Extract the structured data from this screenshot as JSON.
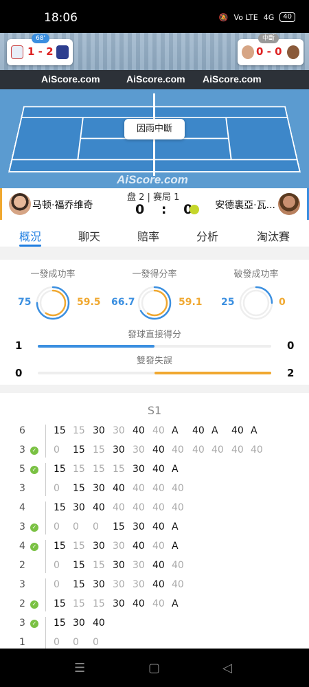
{
  "status": {
    "time": "18:06",
    "battery": "40",
    "signal_text": "4G",
    "volte": "Vo LTE"
  },
  "hero": {
    "ads": [
      "AiScore.com",
      "AiScore.com",
      "AiScore.com"
    ],
    "court_logo": "AiScore.com",
    "rain_label": "因雨中斷",
    "left_card": {
      "minute": "68'",
      "score": "1 - 2"
    },
    "right_card": {
      "status": "中斷",
      "score": "0 - 0"
    }
  },
  "match": {
    "player_left": "马顿·福乔维奇",
    "player_right": "安德裏亞·瓦...",
    "set_info": "盘 2 | 赛局 1",
    "score_left": "0",
    "score_sep": ":",
    "score_right": "0"
  },
  "tabs": [
    "概況",
    "聊天",
    "賠率",
    "分析",
    "淘汰賽"
  ],
  "stats": {
    "first_serve_pct": {
      "title": "一發成功率",
      "left": "75",
      "right": "59.5",
      "left_frac": 0.75,
      "right_frac": 0.595
    },
    "first_serve_won": {
      "title": "一發得分率",
      "left": "66.7",
      "right": "59.1",
      "left_frac": 0.667,
      "right_frac": 0.591
    },
    "break_pct": {
      "title": "破發成功率",
      "left": "25",
      "right": "0",
      "left_frac": 0.25,
      "right_frac": 0
    },
    "aces": {
      "title": "發球直接得分",
      "left": "1",
      "right": "0",
      "left_frac": 0.5,
      "right_frac": 0
    },
    "double_faults": {
      "title": "雙發失誤",
      "left": "0",
      "right": "2",
      "left_frac": 0,
      "right_frac": 0.5
    }
  },
  "pbp": {
    "set_label": "S1",
    "games": [
      {
        "top_score": "6",
        "bottom_score": "3",
        "check": "bottom",
        "top": [
          "15",
          "15",
          "30",
          "30",
          "40",
          "40",
          "A",
          "40",
          "A",
          "40",
          "A"
        ],
        "bottom": [
          "0",
          "15",
          "15",
          "30",
          "30",
          "40",
          "40",
          "40",
          "40",
          "40",
          "40"
        ]
      },
      {
        "top_score": "5",
        "bottom_score": "3",
        "check": "top",
        "top": [
          "15",
          "15",
          "15",
          "15",
          "30",
          "40",
          "A"
        ],
        "bottom": [
          "0",
          "15",
          "30",
          "40",
          "40",
          "40",
          "40"
        ]
      },
      {
        "top_score": "4",
        "bottom_score": "3",
        "check": "bottom",
        "top": [
          "15",
          "30",
          "40",
          "40",
          "40",
          "40",
          "40"
        ],
        "bottom": [
          "0",
          "0",
          "0",
          "15",
          "30",
          "40",
          "A"
        ]
      },
      {
        "top_score": "4",
        "bottom_score": "2",
        "check": "top",
        "top": [
          "15",
          "15",
          "30",
          "30",
          "40",
          "40",
          "A"
        ],
        "bottom": [
          "0",
          "15",
          "15",
          "30",
          "30",
          "40",
          "40"
        ]
      },
      {
        "top_score": "3",
        "bottom_score": "2",
        "check": "bottom",
        "top": [
          "0",
          "15",
          "30",
          "30",
          "30",
          "40",
          "40"
        ],
        "bottom": [
          "15",
          "15",
          "15",
          "30",
          "40",
          "40",
          "A"
        ]
      },
      {
        "top_score": "3",
        "bottom_score": "1",
        "check": "top",
        "top": [
          "15",
          "30",
          "40"
        ],
        "bottom": [
          "0",
          "0",
          "0"
        ]
      }
    ]
  },
  "colors": {
    "accent": "#1e7de0",
    "blue": "#3b8fe0",
    "orange": "#f0a830"
  }
}
